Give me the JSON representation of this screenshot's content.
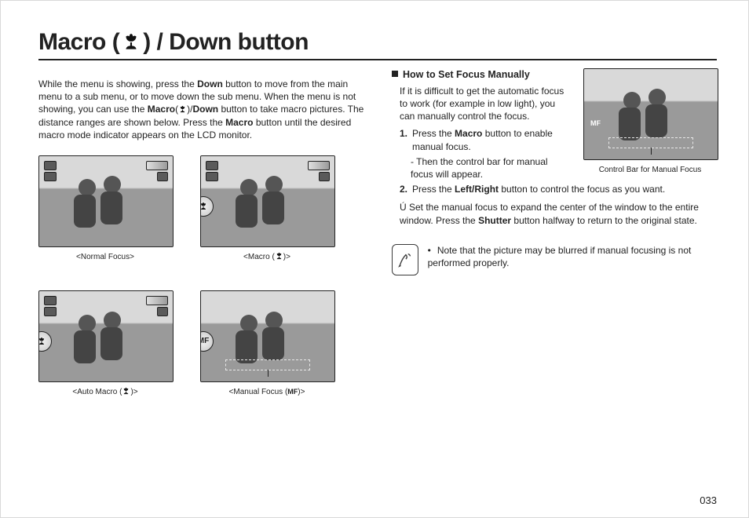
{
  "title": {
    "pre": "Macro (",
    "post": ") / Down button"
  },
  "intro": {
    "t1": "While the menu is showing, press the ",
    "b1": "Down",
    "t2": " button to move from the main menu to a sub menu, or to move down the sub menu. When the menu is not showing, you can use the ",
    "b2": "Macro",
    "t3": "(",
    "t3b": ")/",
    "b3": "Down",
    "t4": " button to take macro pictures. The distance ranges are shown below. Press the ",
    "b4": "Macro",
    "t5": " button until the desired macro mode indicator appears on the LCD monitor."
  },
  "tiles": {
    "normal": "<Normal Focus>",
    "macro_pre": "<Macro (",
    "macro_post": ")>",
    "automacro_pre": "<Auto Macro (",
    "automacro_post": ")>",
    "manual_pre": "<Manual Focus (",
    "manual_post": ")>",
    "mf_badge": "MF"
  },
  "right": {
    "heading": "How to Set Focus Manually",
    "lead": "If it is difficult to get the automatic focus to work (for example in low light), you can manually control the focus.",
    "s1n": "1.",
    "s1a": "Press the ",
    "s1b": "Macro",
    "s1c": " button to enable manual focus.",
    "s1d": "- Then the control bar for manual focus will appear.",
    "s2n": "2.",
    "s2a": "Press the ",
    "s2b": "Left/Right",
    "s2c": " button to control the focus as you want.",
    "starPre": "Ú  Set the manual focus to expand the center of the window to the entire window. Press the ",
    "starB": "Shutter",
    "starPost": " button halfway to return to the original state.",
    "figcap": "Control Bar for Manual Focus",
    "mf": "MF",
    "note": "Note that the picture may be blurred if manual focusing is not performed properly."
  },
  "pagenum": "033"
}
